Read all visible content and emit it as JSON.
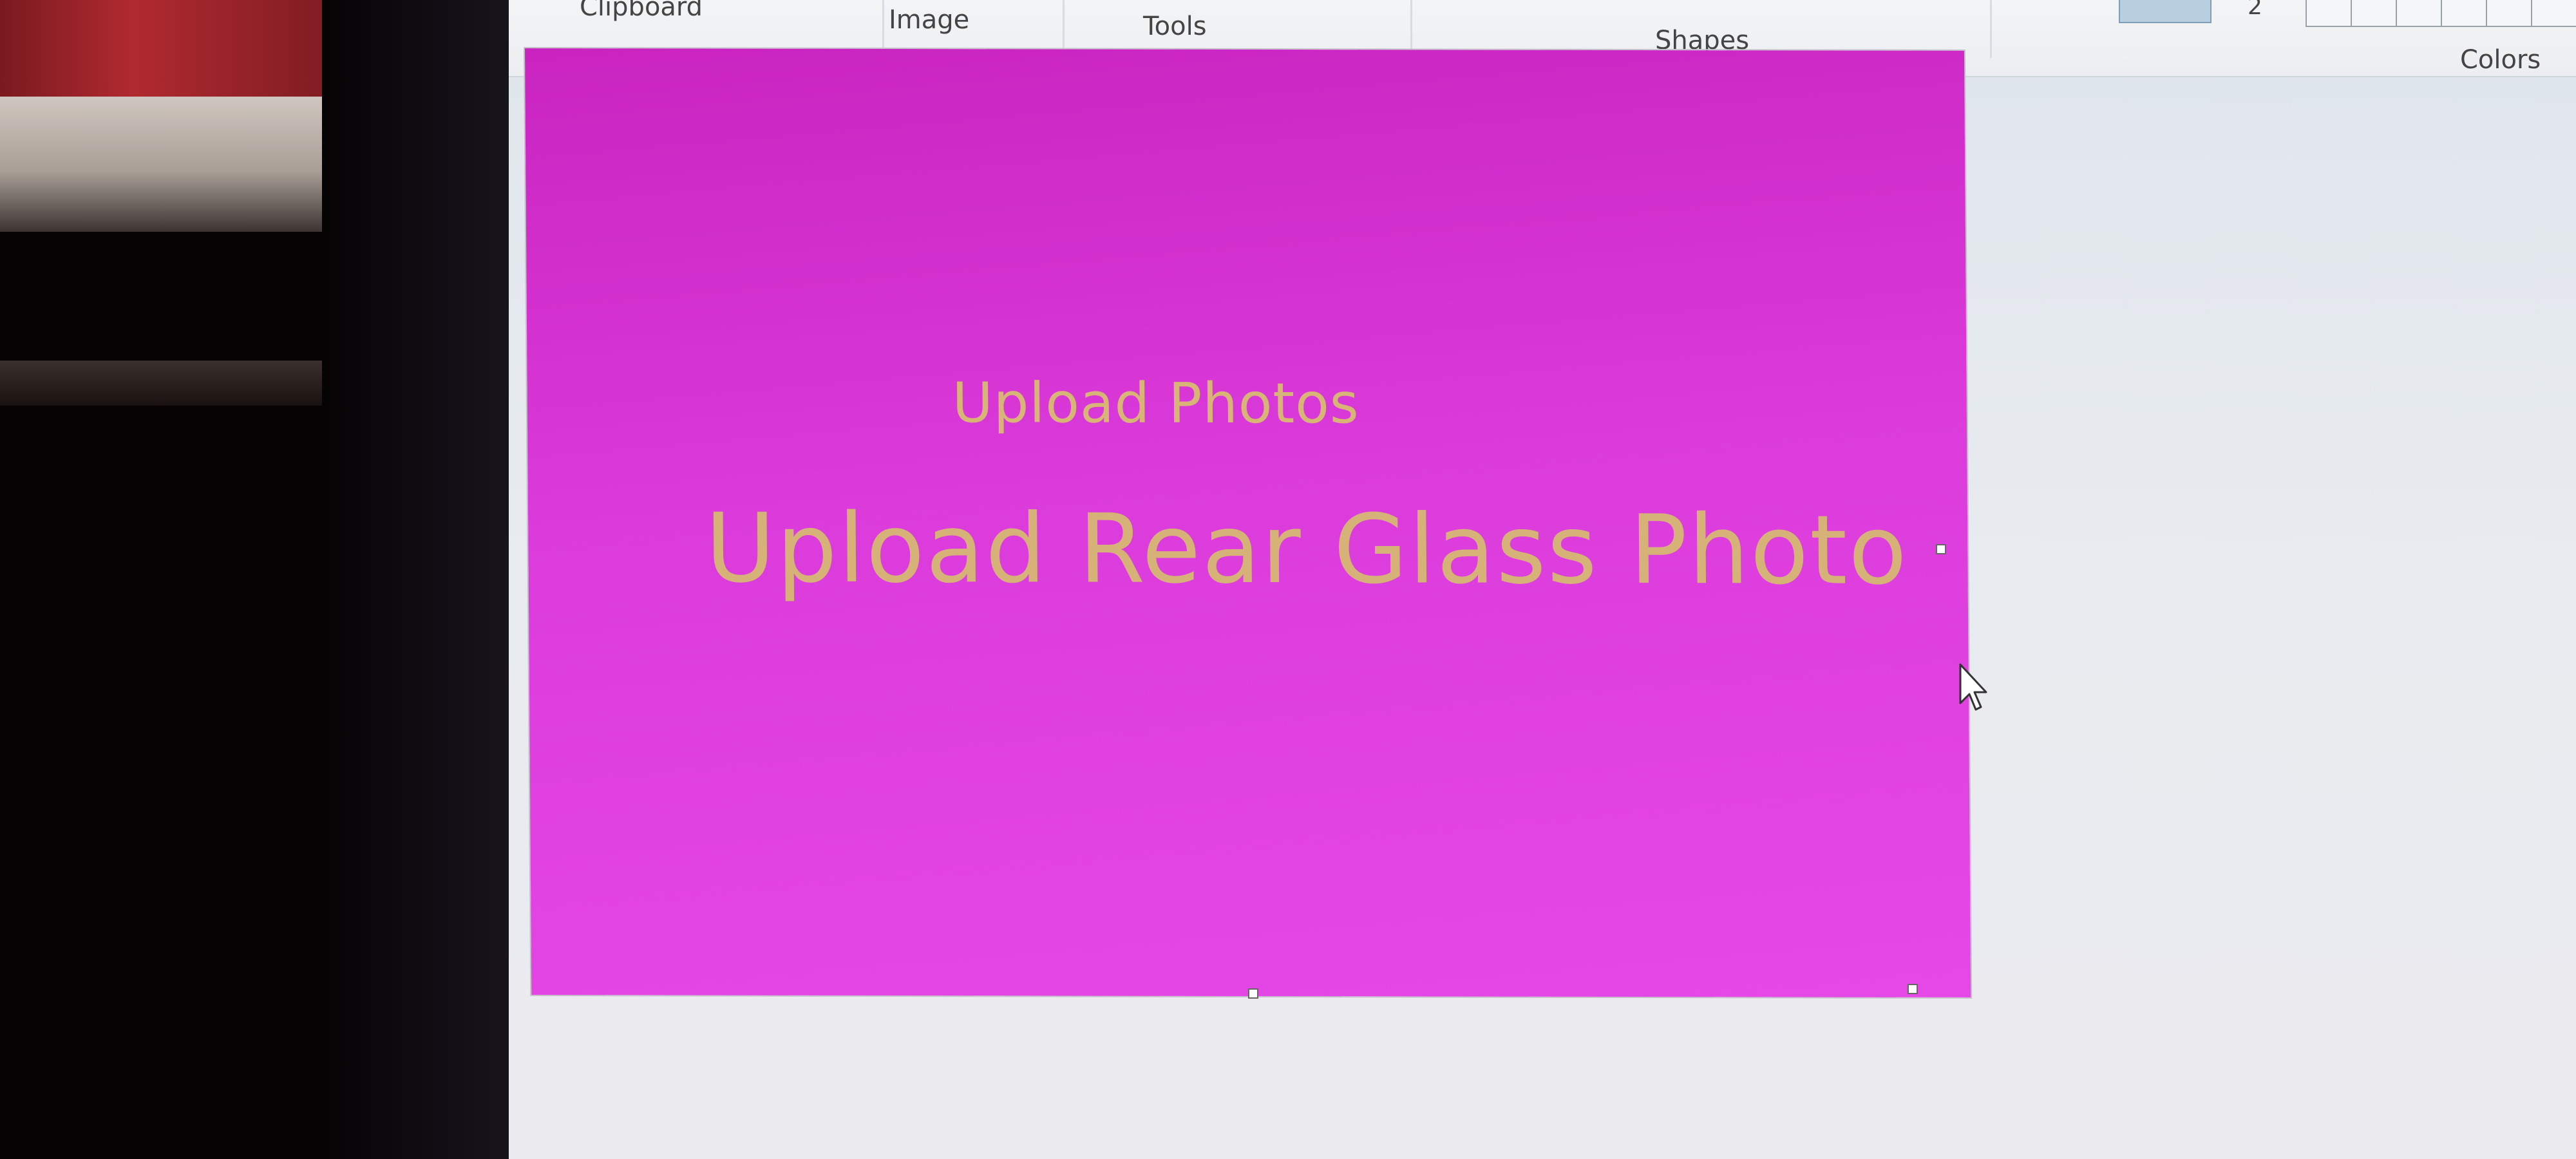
{
  "ribbon": {
    "groups": {
      "clipboard": "Clipboard",
      "image": "Image",
      "tools": "Tools",
      "shapes": "Shapes",
      "colors": "Colors"
    },
    "size_second_label": "2"
  },
  "canvas": {
    "subtitle": "Upload Photos",
    "title": "Upload Rear Glass Photo",
    "background_color": "#e040e0",
    "text_color": "#d6bf6e"
  },
  "icons": {
    "pointer": "mouse-pointer-icon"
  }
}
